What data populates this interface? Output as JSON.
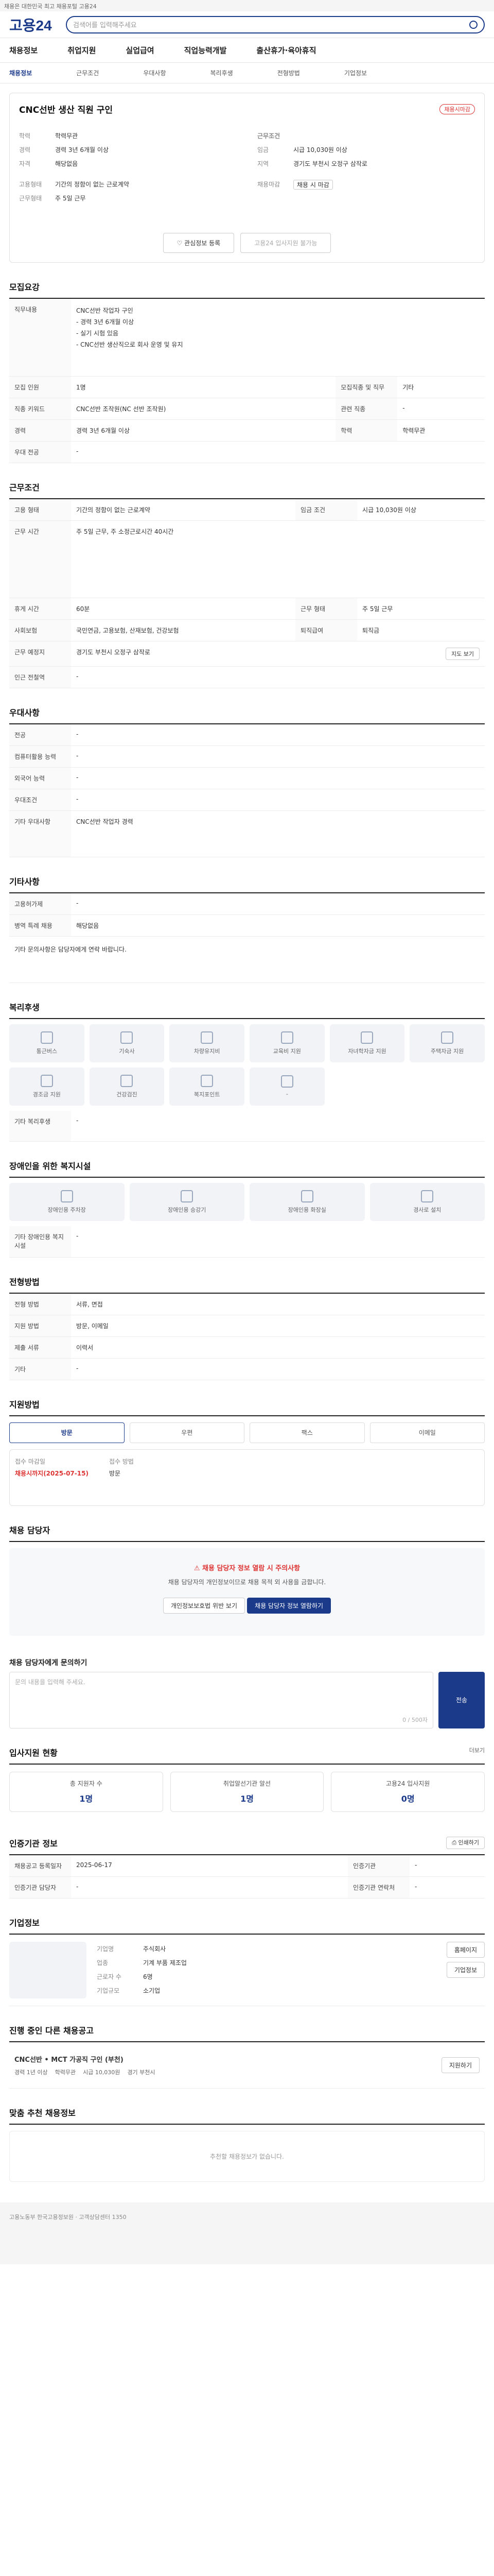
{
  "topbar": {
    "text": "채용은 대한민국 최고 채용포털 고용24"
  },
  "header": {
    "logo": "고용24",
    "search_placeholder": "검색어를 입력해주세요"
  },
  "gnb": [
    "채용정보",
    "취업지원",
    "실업급여",
    "직업능력개발",
    "출산휴가·육아휴직"
  ],
  "lnb": [
    "채용정보",
    "근무조건",
    "우대사항",
    "복리후생",
    "전형방법",
    "기업정보"
  ],
  "job": {
    "title": "CNC선반 생산 직원 구인",
    "badge": "채용시마감",
    "left": [
      {
        "k": "학력",
        "v": "학력무관"
      },
      {
        "k": "경력",
        "v": "경력 3년 6개월 이상"
      },
      {
        "k": "자격",
        "v": "해당없음"
      }
    ],
    "right": [
      {
        "k": "근무조건",
        "v": ""
      },
      {
        "k": "임금",
        "v": "시급 10,030원 이상"
      },
      {
        "k": "지역",
        "v": "경기도 부천시 오정구 삼작로"
      }
    ],
    "employ_type": [
      {
        "k": "고용형태",
        "v": "기간의 정함이 없는 근로계약"
      },
      {
        "k": "근무형태",
        "v": "주 5일 근무"
      }
    ],
    "apply_label": "채용마감",
    "apply_value": "채용 시 마감",
    "btn_interest": "관심정보 등록",
    "btn_apply": "고용24 입사지원 불가능"
  },
  "recruit": {
    "title": "모집요강",
    "duty_label": "직무내용",
    "duty_lines": [
      "CNC선반 작업자 구인",
      "- 경력 3년 6개월 이상",
      "- 실기 시험 있음",
      "- CNC선반 생산직으로 회사 운영 및 유지"
    ],
    "rows": [
      {
        "k": "모집 인원",
        "v": "1명",
        "k2": "모집직종 및 직무",
        "v2": "기타"
      },
      {
        "k": "직종 키워드",
        "v": "CNC선반 조작원(NC 선반 조작원)",
        "k2": "관련 직종",
        "v2": "-"
      },
      {
        "k": "경력",
        "v": "경력 3년 6개월 이상",
        "k2": "학력",
        "v2": "학력무관"
      },
      {
        "k": "우대 전공",
        "v": "-",
        "k2": "",
        "v2": ""
      }
    ]
  },
  "work": {
    "title": "근무조건",
    "rows": [
      {
        "k": "고용 형태",
        "v": "기간의 정함이 없는 근로계약",
        "k2": "임금 조건",
        "v2": "시급 10,030원 이상"
      },
      {
        "k": "근무 시간",
        "v": "주 5일 근무, 주 소정근로시간 40시간",
        "k2": "",
        "v2": ""
      },
      {
        "k": "휴게 시간",
        "v": "60분",
        "k2": "근무 형태",
        "v2": "주 5일 근무"
      },
      {
        "k": "사회보험",
        "v": "국민연금, 고용보험, 산재보험, 건강보험",
        "k2": "퇴직급여",
        "v2": "퇴직금"
      },
      {
        "k": "근무 예정지",
        "v": "경기도 부천시 오정구 삼작로",
        "k2": "",
        "v2": ""
      },
      {
        "k": "인근 전철역",
        "v": "-",
        "k2": "",
        "v2": ""
      }
    ],
    "map_btn": "지도 보기"
  },
  "prefer": {
    "title": "우대사항",
    "rows": [
      {
        "k": "전공",
        "v": "-"
      },
      {
        "k": "컴퓨터활용 능력",
        "v": "-"
      },
      {
        "k": "외국어 능력",
        "v": "-"
      },
      {
        "k": "우대조건",
        "v": "-"
      },
      {
        "k": "기타 우대사항",
        "v": "CNC선반 작업자 경력"
      }
    ]
  },
  "etc": {
    "title": "기타사항",
    "rows": [
      {
        "k": "고용허가제",
        "v": "-"
      },
      {
        "k": "병역 특례 채용",
        "v": "해당없음"
      }
    ],
    "extra": "기타 문의사항은 담당자에게 연락 바랍니다."
  },
  "welfare": {
    "title": "복리후생",
    "items": [
      "통근버스",
      "기숙사",
      "차량유지비",
      "교육비 지원",
      "자녀학자금 지원",
      "주택자금 지원",
      "경조금 지원",
      "건강검진",
      "복지포인트",
      "-"
    ],
    "other_label": "기타 복리후생",
    "other_value": "-"
  },
  "disability": {
    "title": "장애인을 위한 복지시설",
    "items": [
      "장애인용 주차장",
      "장애인용 승강기",
      "장애인용 화장실",
      "경사로 설치"
    ],
    "other_label": "기타 장애인용 복지시설",
    "other_value": "-"
  },
  "process": {
    "title": "전형방법",
    "rows": [
      {
        "k": "전형 방법",
        "v": "서류, 면접"
      },
      {
        "k": "지원 방법",
        "v": "방문, 이메일"
      },
      {
        "k": "제출 서류",
        "v": "이력서"
      },
      {
        "k": "기타",
        "v": "-"
      }
    ]
  },
  "apply_method": {
    "title": "지원방법",
    "tabs": [
      "방문",
      "우편",
      "팩스",
      "이메일"
    ],
    "receive_label": "접수 마감일",
    "receive_value": "채용시까지(2025-07-15)",
    "contact_label": "접수 방법",
    "contact_value": "방문"
  },
  "manager": {
    "title": "채용 담당자",
    "warn_title": "채용 담당자 정보 열람 시 주의사항",
    "warn_text": "채용 담당자의 개인정보이므로 채용 목적 외 사용을 금합니다.",
    "btn_view": "개인정보보호법 위반 보기",
    "btn_agree": "채용 담당자 정보 열람하기"
  },
  "inquiry": {
    "title": "채용 담당자에게 문의하기",
    "placeholder": "문의 내용을 입력해 주세요.",
    "btn": "전송",
    "count": "0 / 500자"
  },
  "status": {
    "title": "입사지원 현황",
    "items": [
      {
        "k": "총 지원자 수",
        "v": "1명"
      },
      {
        "k": "취업알선기관 알선",
        "v": "1명"
      },
      {
        "k": "고용24 입사지원",
        "v": "0명"
      }
    ],
    "more": "더보기"
  },
  "reg": {
    "title": "인증기관 정보",
    "rows": [
      {
        "k": "채용공고 등록일자",
        "v": "2025-06-17",
        "k2": "인증기관",
        "v2": "-"
      },
      {
        "k": "인증기관 담당자",
        "v": "-",
        "k2": "인증기관 연락처",
        "v2": "-"
      }
    ],
    "print_btn": "인쇄하기"
  },
  "company": {
    "title": "기업정보",
    "rows": [
      {
        "k": "기업명",
        "v": "주식회사"
      },
      {
        "k": "업종",
        "v": "기계 부품 제조업"
      },
      {
        "k": "근로자 수",
        "v": "6명"
      },
      {
        "k": "기업규모",
        "v": "소기업"
      }
    ],
    "btn1": "홈페이지",
    "btn2": "기업정보"
  },
  "similar": {
    "title": "진행 중인 다른 채용공고",
    "item_title": "CNC선반 • MCT 가공직 구인 (부천)",
    "item_meta": [
      "경력 1년 이상",
      "학력무관",
      "시급 10,030원",
      "경기 부천시"
    ],
    "btn": "지원하기"
  },
  "recommend": {
    "title": "맞춤 추천 채용정보",
    "empty": "추천할 채용정보가 없습니다."
  },
  "footer": {
    "text": "고용노동부 한국고용정보원 · 고객상담센터 1350"
  }
}
